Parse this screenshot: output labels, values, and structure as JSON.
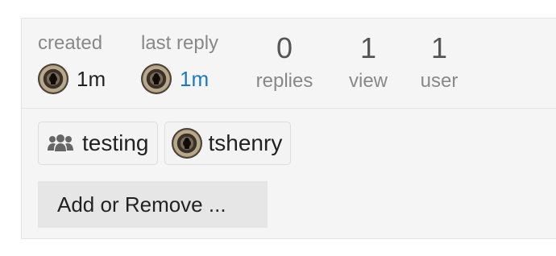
{
  "topic_map": {
    "created": {
      "label": "created",
      "value": "1m",
      "avatar_icon": "user-avatar"
    },
    "last_reply": {
      "label": "last reply",
      "value": "1m",
      "avatar_icon": "user-avatar"
    },
    "replies": {
      "count": "0",
      "label": "replies"
    },
    "views": {
      "count": "1",
      "label": "view"
    },
    "users": {
      "count": "1",
      "label": "user"
    },
    "participants": [
      {
        "name": "testing",
        "icon": "group-icon"
      },
      {
        "name": "tshenry",
        "icon": "user-avatar"
      }
    ],
    "add_remove_label": "Add or Remove ...",
    "colors": {
      "link": "#1a7bc2",
      "background": "#f5f5f5",
      "muted_text": "#888888"
    }
  }
}
